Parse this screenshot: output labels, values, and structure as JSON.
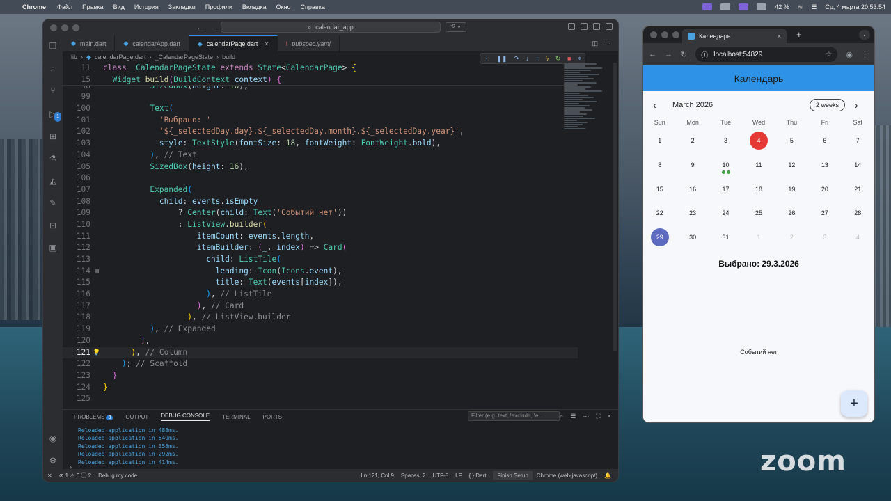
{
  "menubar": {
    "app": "Chrome",
    "items": [
      "Файл",
      "Правка",
      "Вид",
      "История",
      "Закладки",
      "Профили",
      "Вкладка",
      "Окно",
      "Справка"
    ],
    "battery": "42 %",
    "clock": "Ср, 4 марта  20:53:54"
  },
  "vscode": {
    "search": "calendar_app",
    "tabs": [
      {
        "label": "main.dart",
        "kind": "dart"
      },
      {
        "label": "calendarApp.dart",
        "kind": "dart"
      },
      {
        "label": "calendarPage.dart",
        "kind": "dart",
        "active": true
      },
      {
        "label": "pubspec.yaml",
        "kind": "yaml"
      }
    ],
    "breadcrumb": [
      "lib",
      "calendarPage.dart",
      "_CalendarPageState",
      "build"
    ],
    "activity_badge": "1",
    "panel": {
      "tabs": [
        "PROBLEMS",
        "OUTPUT",
        "DEBUG CONSOLE",
        "TERMINAL",
        "PORTS"
      ],
      "problems_count": "3",
      "filter_placeholder": "Filter (e.g. text, !exclude, \\e...",
      "console": [
        "Reloaded application in 488ms.",
        "Reloaded application in 549ms.",
        "Reloaded application in 358ms.",
        "Reloaded application in 292ms.",
        "Reloaded application in 414ms."
      ]
    },
    "status": {
      "errors": "1",
      "warnings": "0",
      "info": "2",
      "debug": "Debug my code",
      "position": "Ln 121, Col 9",
      "spaces": "Spaces: 2",
      "encoding": "UTF-8",
      "eol": "LF",
      "lang": "Dart",
      "finish": "Finish Setup",
      "device": "Chrome (web-javascript)"
    }
  },
  "chrome": {
    "tab_title": "Календарь",
    "url": "localhost:54829",
    "app_title": "Календарь",
    "month": "March 2026",
    "format": "2 weeks",
    "weekdays": [
      "Sun",
      "Mon",
      "Tue",
      "Wed",
      "Thu",
      "Fri",
      "Sat"
    ],
    "days": [
      [
        "1",
        "2",
        "3",
        "4",
        "5",
        "6",
        "7"
      ],
      [
        "8",
        "9",
        "10",
        "11",
        "12",
        "13",
        "14"
      ],
      [
        "15",
        "16",
        "17",
        "18",
        "19",
        "20",
        "21"
      ],
      [
        "22",
        "23",
        "24",
        "25",
        "26",
        "27",
        "28"
      ],
      [
        "29",
        "30",
        "31",
        "1",
        "2",
        "3",
        "4"
      ]
    ],
    "today": "4",
    "selected": "29",
    "event_day": "10",
    "selected_label": "Выбрано: 29.3.2026",
    "no_events": "Событий нет",
    "fab": "+"
  },
  "zoom": "zoom"
}
